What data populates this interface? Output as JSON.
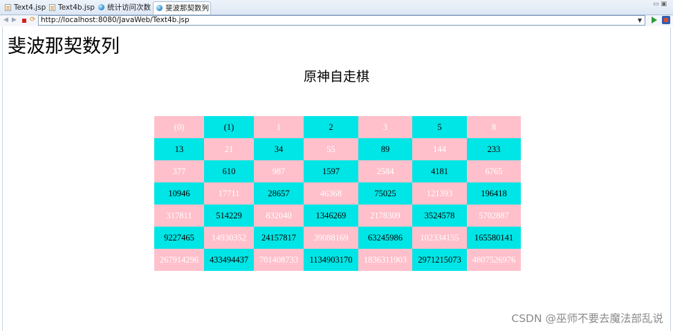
{
  "tabs": [
    {
      "label": "Text4.jsp",
      "icon": "jsp-file-icon",
      "active": false
    },
    {
      "label": "Text4b.jsp",
      "icon": "jsp-file-icon",
      "active": false
    },
    {
      "label": "统计访问次数",
      "icon": "web-browser-icon",
      "active": false
    },
    {
      "label": "斐波那契数列",
      "icon": "web-browser-icon",
      "active": true
    }
  ],
  "address_bar": {
    "url": "http://localhost:8080/JavaWeb/Text4b.jsp"
  },
  "page": {
    "title": "斐波那契数列",
    "subtitle": "原神自走棋"
  },
  "table": {
    "rows": [
      [
        "(0)",
        "(1)",
        "1",
        "2",
        "3",
        "5",
        "8"
      ],
      [
        "13",
        "21",
        "34",
        "55",
        "89",
        "144",
        "233"
      ],
      [
        "377",
        "610",
        "987",
        "1597",
        "2584",
        "4181",
        "6765"
      ],
      [
        "10946",
        "17711",
        "28657",
        "46368",
        "75025",
        "121393",
        "196418"
      ],
      [
        "317811",
        "514229",
        "832040",
        "1346269",
        "2178309",
        "3524578",
        "5702887"
      ],
      [
        "9227465",
        "14930352",
        "24157817",
        "39088169",
        "63245986",
        "102334155",
        "165580141"
      ],
      [
        "267914296",
        "433494437",
        "701408733",
        "1134903170",
        "1836311903",
        "2971215073",
        "4807526976"
      ]
    ],
    "colors": {
      "pink": "#ffc0cb",
      "cyan": "#00e5e5",
      "pink_text": "#ffffff",
      "cyan_text": "#000000"
    }
  },
  "watermark": "CSDN @巫师不要去魔法部乱说"
}
